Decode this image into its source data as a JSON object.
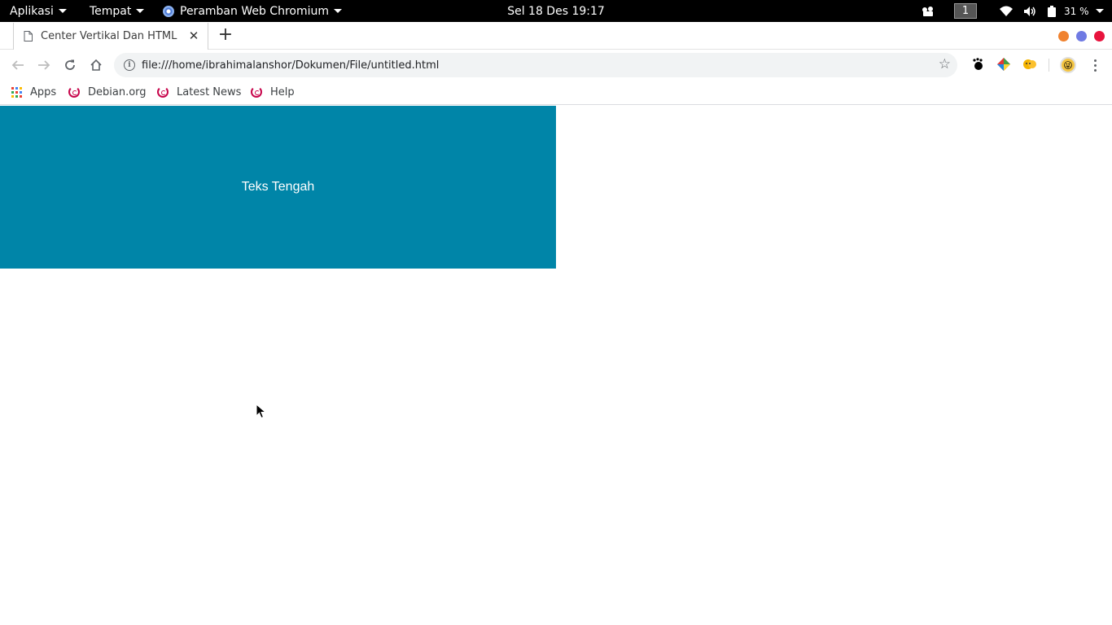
{
  "panel": {
    "applications": "Aplikasi",
    "places": "Tempat",
    "app_menu": "Peramban Web Chromium",
    "clock": "Sel 18 Des  19:17",
    "workspace": "1",
    "battery": "31 %"
  },
  "browser": {
    "tab_title": "Center Vertikal Dan HTML",
    "url": "file:///home/ibrahimalanshor/Dokumen/File/untitled.html",
    "bookmarks": [
      "Apps",
      "Debian.org",
      "Latest News",
      "Help"
    ]
  },
  "page": {
    "box_text": "Teks Tengah",
    "box_color": "#0085a8"
  },
  "icons": {
    "tab": "page-icon",
    "window_controls": [
      "minimize-button-orange",
      "maximize-button-blue",
      "close-button-red"
    ],
    "extensions": [
      "gnome-foot-icon",
      "colorful-extension-icon",
      "smiley-extension-icon"
    ]
  }
}
